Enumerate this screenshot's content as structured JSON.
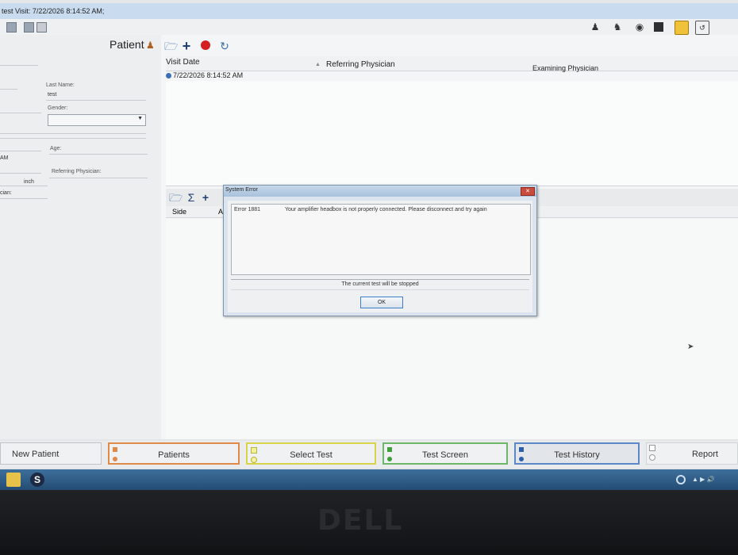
{
  "window": {
    "title": "test  Visit: 7/22/2026 8:14:52 AM;"
  },
  "patient_panel": {
    "title": "Patient",
    "last_name_label": "Last Name:",
    "last_name_value": "test",
    "gender_label": "Gender:",
    "age_label": "Age:",
    "referring_label": "Referring Physician:",
    "am_fragment": "AM",
    "inch_label": "inch",
    "cian_fragment": "cian:"
  },
  "visits": {
    "headers": [
      "Visit Date",
      "Referring Physician",
      "Examining Physician"
    ],
    "sort_indicator": "▲",
    "rows": [
      {
        "date": "7/22/2026 8:14:52 AM"
      }
    ]
  },
  "lower_table": {
    "side_header": "Side",
    "a_fragment": "A"
  },
  "dialog": {
    "title": "System Error",
    "close_label": "✕",
    "error_code": "Error 1881",
    "message": "Your amplifier headbox is not properly connected. Please disconnect and try again",
    "status": "The current test will be stopped",
    "ok_label": "OK"
  },
  "tabs": {
    "new_patient": "New Patient",
    "patients": "Patients",
    "select_test": "Select Test",
    "test_screen": "Test Screen",
    "test_history": "Test History",
    "report": "Report"
  },
  "colors": {
    "patients_accent": "#e08a4a",
    "select_accent": "#d8d44a",
    "screen_accent": "#6cb76a",
    "history_accent": "#5d88c8",
    "record_red": "#d42020"
  },
  "icons": [
    "folder-icon",
    "add-icon",
    "record-icon",
    "refresh-icon",
    "add-user-icon",
    "patients-icon",
    "disk-icon",
    "monitor-icon",
    "notes-icon",
    "export-icon"
  ],
  "bezel": {
    "brand": "DELL"
  }
}
